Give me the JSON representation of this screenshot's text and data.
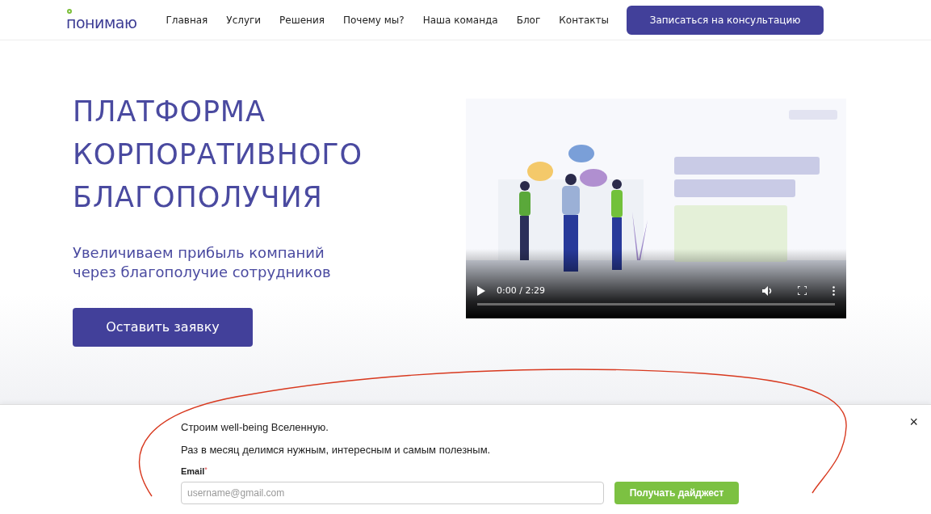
{
  "header": {
    "logo": "понимаю",
    "nav": [
      {
        "label": "Главная"
      },
      {
        "label": "Услуги"
      },
      {
        "label": "Решения"
      },
      {
        "label": "Почему мы?"
      },
      {
        "label": "Наша команда"
      },
      {
        "label": "Блог"
      },
      {
        "label": "Контакты"
      }
    ],
    "cta": "Записаться на консультацию"
  },
  "hero": {
    "title_lines": [
      "ПЛАТФОРМА",
      "КОРПОРАТИВНОГО",
      "БЛАГОПОЛУЧИЯ"
    ],
    "subtitle_lines": [
      "Увеличиваем прибыль компаний",
      "через благополучие сотрудников"
    ],
    "button": "Оставить заявку"
  },
  "video": {
    "kind": "picture",
    "time": "0:00 / 2:29"
  },
  "popup": {
    "line_1": "Строим well-being Вселенную.",
    "line_2": "Раз в месяц делимся нужным, интересным и самым полезным.",
    "email_label": "Email",
    "required_mark": "*",
    "placeholder": "username@gmail.com",
    "submit": "Получать дайджест",
    "close": "×"
  }
}
